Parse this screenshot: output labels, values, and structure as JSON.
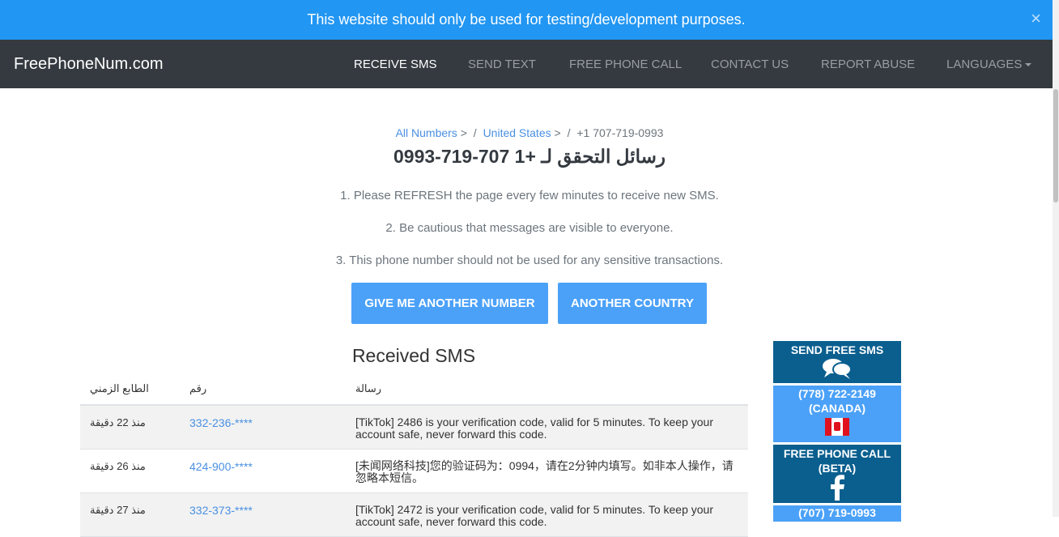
{
  "banner": {
    "text": "This website should only be used for testing/development purposes.",
    "close": "×"
  },
  "navbar": {
    "brand": "FreePhoneNum.com",
    "items": [
      {
        "label": "RECEIVE SMS",
        "active": true
      },
      {
        "label": "SEND TEXT"
      },
      {
        "label": "FREE PHONE CALL"
      },
      {
        "label": "CONTACT US"
      },
      {
        "label": "REPORT ABUSE"
      },
      {
        "label": "LANGUAGES"
      }
    ]
  },
  "breadcrumb": {
    "all": "All Numbers",
    "country": "United States",
    "current": "+1 707-719-0993",
    "gt": ">",
    "slash": "/"
  },
  "title": "رسائل التحقق لـ +1 707-719-0993",
  "notes": [
    "1. Please REFRESH the page every few minutes to receive new SMS.",
    "2. Be cautious that messages are visible to everyone.",
    "3. This phone number should not be used for any sensitive transactions."
  ],
  "buttons": {
    "another_number": "GIVE ME ANOTHER NUMBER",
    "another_country": "ANOTHER COUNTRY"
  },
  "received": {
    "title": "Received SMS",
    "headers": {
      "time": "الطابع الزمني",
      "number": "رقم",
      "message": "رسالة"
    },
    "rows": [
      {
        "time": "منذ 22 دقيقة",
        "number": "332-236-****",
        "message": "[TikTok] 2486 is your verification code, valid for 5 minutes. To keep your account safe, never forward this code."
      },
      {
        "time": "منذ 26 دقيقة",
        "number": "424-900-****",
        "message": "[未闻网络科技]您的验证码为：0994，请在2分钟内填写。如非本人操作，请忽略本短信。"
      },
      {
        "time": "منذ 27 دقيقة",
        "number": "332-373-****",
        "message": "[TikTok] 2472 is your verification code, valid for 5 minutes. To keep your account safe, never forward this code."
      }
    ]
  },
  "sidebar": {
    "send_sms": "SEND FREE SMS",
    "canada_number": "(778) 722-2149",
    "canada_label": "(CANADA)",
    "free_call": "FREE PHONE CALL",
    "beta": "(BETA)",
    "next_number": "(707) 719-0993"
  },
  "colors": {
    "banner": "#2196f3",
    "navbar": "#343a40",
    "button": "#4ba1f8",
    "side_dark": "#0a5f8f",
    "link": "#4a90e2"
  }
}
